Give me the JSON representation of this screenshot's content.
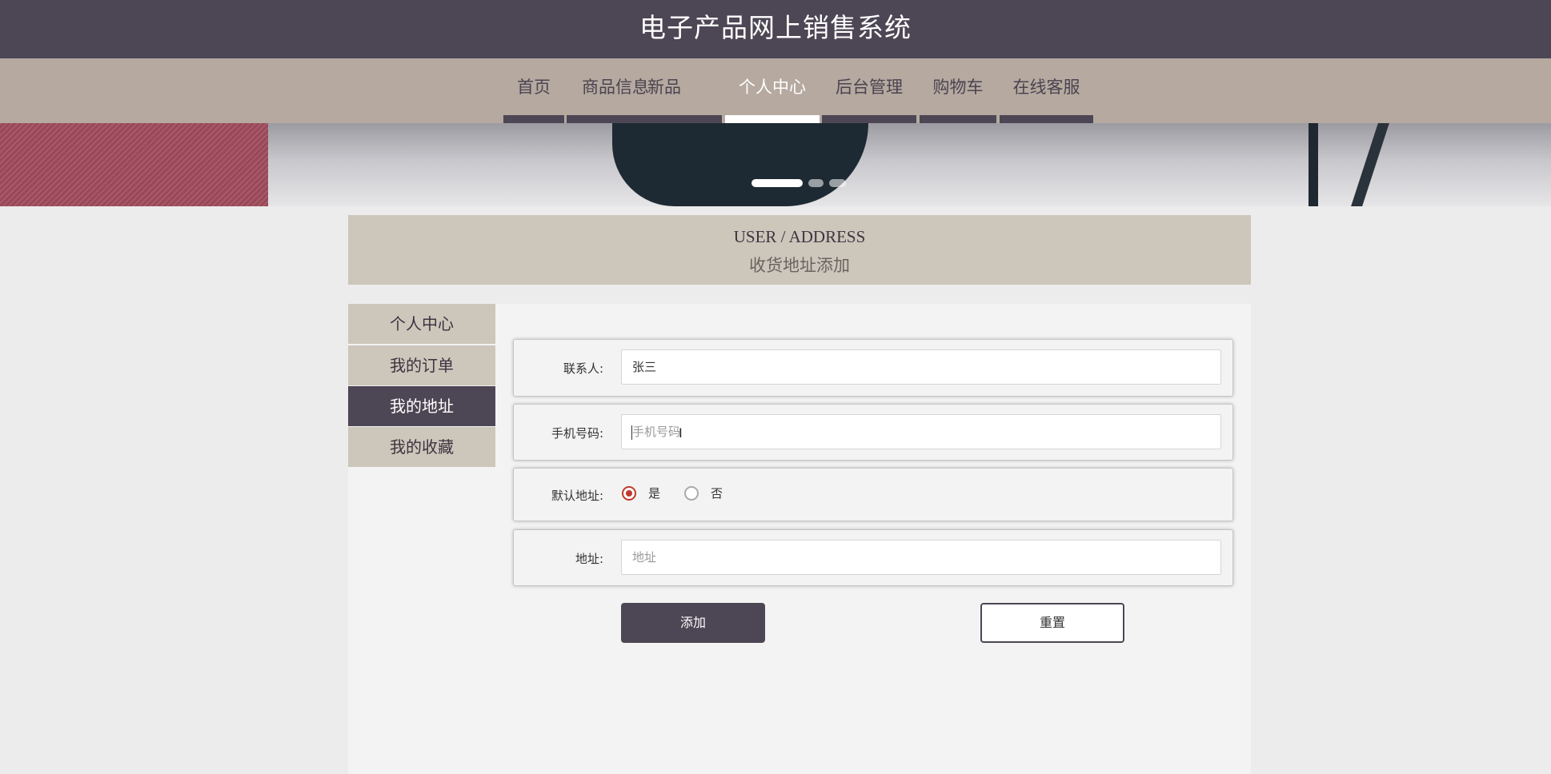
{
  "header": {
    "title": "电子产品网上销售系统"
  },
  "nav": {
    "items": [
      {
        "label": "首页"
      },
      {
        "label": "商品信息"
      },
      {
        "label": "新品"
      },
      {
        "label": "个人中心",
        "active": true
      },
      {
        "label": "后台管理"
      },
      {
        "label": "购物车"
      },
      {
        "label": "在线客服"
      }
    ]
  },
  "carousel": {
    "slide_count": 3,
    "active_index": 0
  },
  "page": {
    "title_en": "USER / ADDRESS",
    "title_zh": "收货地址添加"
  },
  "sidebar": {
    "items": [
      {
        "label": "个人中心"
      },
      {
        "label": "我的订单"
      },
      {
        "label": "我的地址",
        "active": true
      },
      {
        "label": "我的收藏"
      }
    ]
  },
  "form": {
    "contact": {
      "label": "联系人:",
      "value": "张三"
    },
    "phone": {
      "label": "手机号码:",
      "placeholder": "手机号码",
      "value": ""
    },
    "default": {
      "label": "默认地址:",
      "yes": "是",
      "no": "否",
      "selected": "是"
    },
    "address": {
      "label": "地址:",
      "placeholder": "地址",
      "value": ""
    },
    "add_button": "添加",
    "reset_button": "重置"
  },
  "colors": {
    "primary": "#4d4654",
    "nav_bg": "#b5a9a0",
    "beige": "#cdc6bb",
    "radio_accent": "#c0392b"
  }
}
